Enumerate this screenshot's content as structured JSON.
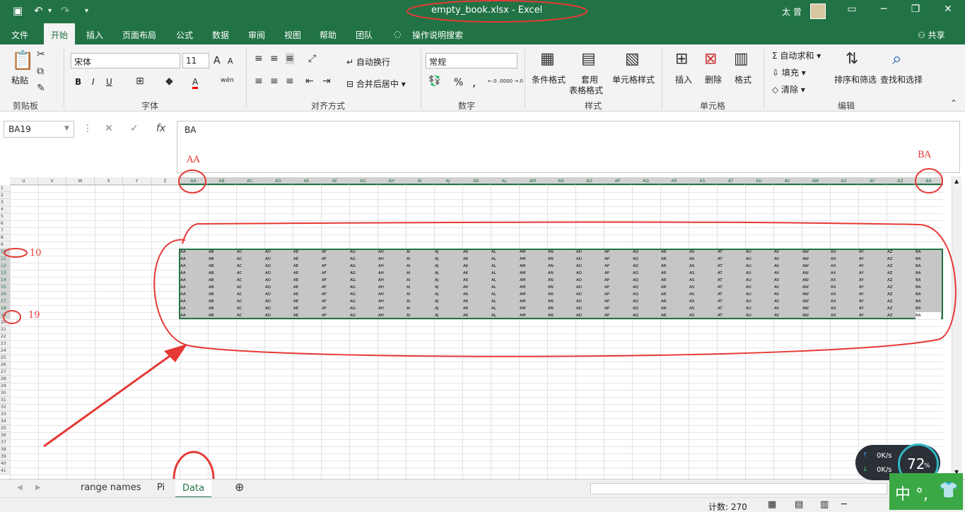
{
  "titlebar": {
    "title": "empty_book.xlsx  -  Excel",
    "user": "太 曾",
    "undo_icon": "undo-icon",
    "redo_icon": "redo-icon",
    "save_icon": "save-icon"
  },
  "tabs": {
    "items": [
      "文件",
      "开始",
      "插入",
      "页面布局",
      "公式",
      "数据",
      "审阅",
      "视图",
      "帮助",
      "团队"
    ],
    "active": "开始",
    "tell_me": "操作说明搜索",
    "share": "共享"
  },
  "ribbon": {
    "clipboard": {
      "paste": "粘贴",
      "label": "剪贴板"
    },
    "font": {
      "name": "宋体",
      "size": "11",
      "bold": "B",
      "italic": "I",
      "underline": "U",
      "grow": "A",
      "shrink": "A",
      "color": "A",
      "phonetic": "wén",
      "label": "字体"
    },
    "alignment": {
      "wrap": "自动换行",
      "merge": "合并后居中",
      "label": "对齐方式"
    },
    "number": {
      "format": "常规",
      "percent": "%",
      "comma": ",",
      "label": "数字",
      "inc_decimal": "←.0 .00",
      "dec_decimal": ".00 →.0"
    },
    "styles": {
      "conditional": "条件格式",
      "table_line1": "套用",
      "table_line2": "表格格式",
      "cell_styles": "单元格样式",
      "label": "样式"
    },
    "cells": {
      "insert": "插入",
      "delete": "删除",
      "format": "格式",
      "label": "单元格"
    },
    "editing": {
      "autosum": "自动求和",
      "fill": "填充",
      "clear": "清除",
      "sort": "排序和筛选",
      "find": "查找和选择",
      "label": "编辑"
    }
  },
  "formulabar": {
    "namebox": "BA19",
    "cancel": "✕",
    "enter": "✓",
    "fx": "fx",
    "value": "BA"
  },
  "grid": {
    "left_columns": [
      "U",
      "V",
      "W",
      "X",
      "Y",
      "Z"
    ],
    "columns": [
      "AA",
      "AB",
      "AC",
      "AD",
      "AE",
      "AF",
      "AG",
      "AH",
      "AI",
      "AJ",
      "AK",
      "AL",
      "AM",
      "AN",
      "AO",
      "AP",
      "AQ",
      "AR",
      "AS",
      "AT",
      "AU",
      "AV",
      "AW",
      "AX",
      "AY",
      "AZ",
      "BA"
    ],
    "rows": [
      "1",
      "2",
      "3",
      "4",
      "5",
      "6",
      "7",
      "8",
      "9",
      "10",
      "11",
      "12",
      "13",
      "14",
      "15",
      "16",
      "17",
      "18",
      "19",
      "20",
      "21",
      "22",
      "23",
      "24",
      "25",
      "26",
      "27",
      "28",
      "29",
      "30",
      "31",
      "32",
      "33",
      "34",
      "35",
      "36",
      "37",
      "38",
      "39",
      "40",
      "41"
    ],
    "data_first_row": 10,
    "data_last_row": 19
  },
  "annotations": {
    "aa": "AA",
    "ba": "BA",
    "r10": "10",
    "r19": "19"
  },
  "sheets": {
    "tabs": [
      "range names",
      "Pi",
      "Data"
    ],
    "active": "Data",
    "add": "⊕"
  },
  "status": {
    "count": "计数: 270"
  },
  "overlay": {
    "net_up": "0K/s",
    "net_down": "0K/s",
    "percent": "72",
    "percent_unit": "%",
    "ime": "中 °,"
  }
}
